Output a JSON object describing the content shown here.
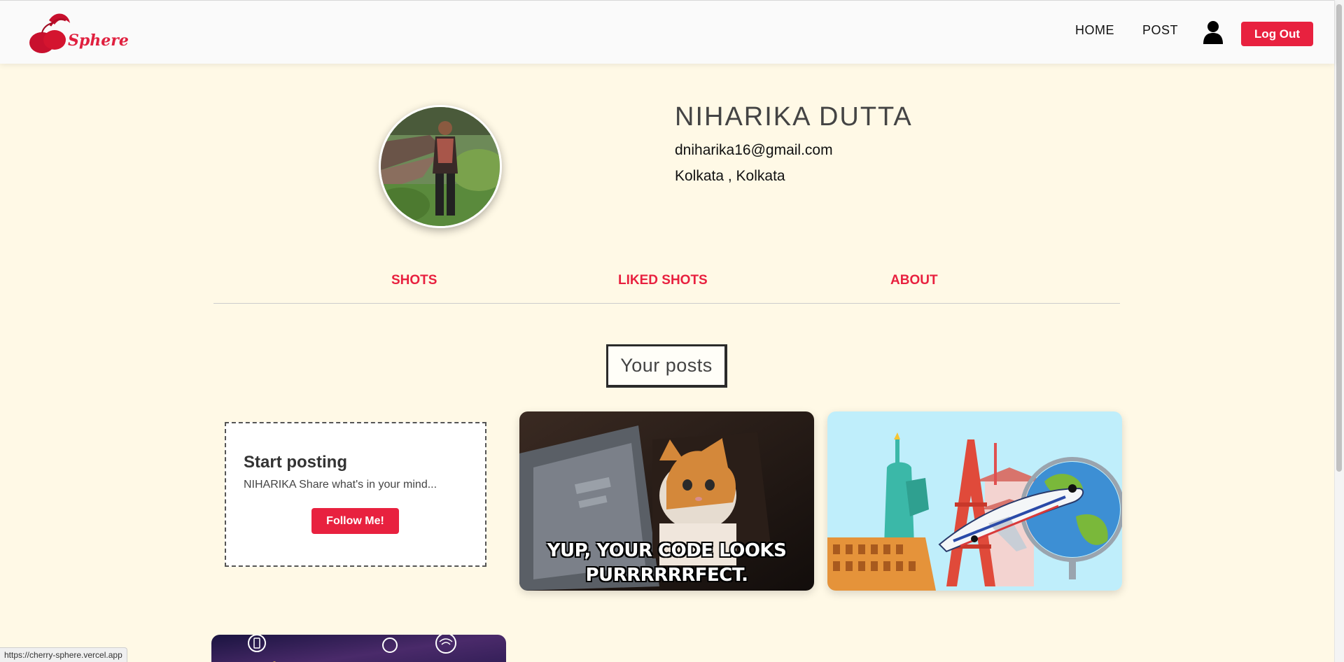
{
  "app": {
    "name": "Cherry Sphere",
    "logo_text": "Sphere"
  },
  "nav": {
    "home_label": "HOME",
    "post_label": "POST",
    "logout_label": "Log Out"
  },
  "profile": {
    "name": "NIHARIKA DUTTA",
    "email": "dniharika16@gmail.com",
    "location": "Kolkata , Kolkata"
  },
  "tabs": [
    {
      "label": "SHOTS"
    },
    {
      "label": "LIKED SHOTS"
    },
    {
      "label": "ABOUT"
    }
  ],
  "section": {
    "title": "Your posts"
  },
  "start_card": {
    "title": "Start posting",
    "description": "NIHARIKA Share what's in your mind...",
    "button_label": "Follow Me!"
  },
  "posts": [
    {
      "image": "cat-laptop-meme",
      "caption_line1": "YUP, YOUR CODE LOOKS",
      "caption_line2": "PURRRRRRFECT."
    },
    {
      "image": "travel-landmarks-illustration"
    },
    {
      "image": "smart-city-night"
    }
  ],
  "status_url": "https://cherry-sphere.vercel.app",
  "colors": {
    "accent": "#e8213f",
    "background": "#fff9e6",
    "navbar": "#fafafa"
  }
}
